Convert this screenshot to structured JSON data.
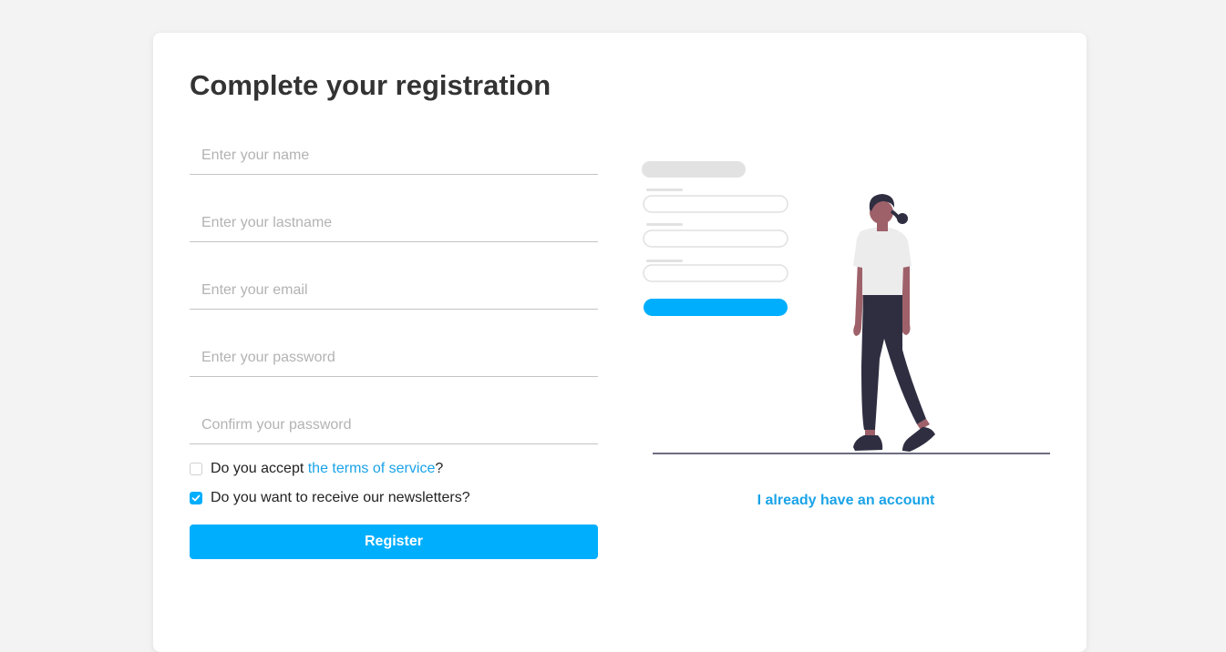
{
  "form": {
    "title": "Complete your registration",
    "fields": {
      "name_placeholder": "Enter your name",
      "lastname_placeholder": "Enter your lastname",
      "email_placeholder": "Enter your email",
      "password_placeholder": "Enter your password",
      "confirm_placeholder": "Confirm your password"
    },
    "terms": {
      "prefix": "Do you accept ",
      "link": "the terms of service",
      "suffix": "?",
      "checked": false
    },
    "newsletter": {
      "label": "Do you want to receive our newsletters?",
      "checked": true
    },
    "register_label": "Register"
  },
  "side": {
    "have_account_link": "I already have an account"
  },
  "colors": {
    "accent": "#00aefe",
    "link": "#1aa3e8",
    "title": "#333333",
    "background": "#f3f3f3"
  }
}
